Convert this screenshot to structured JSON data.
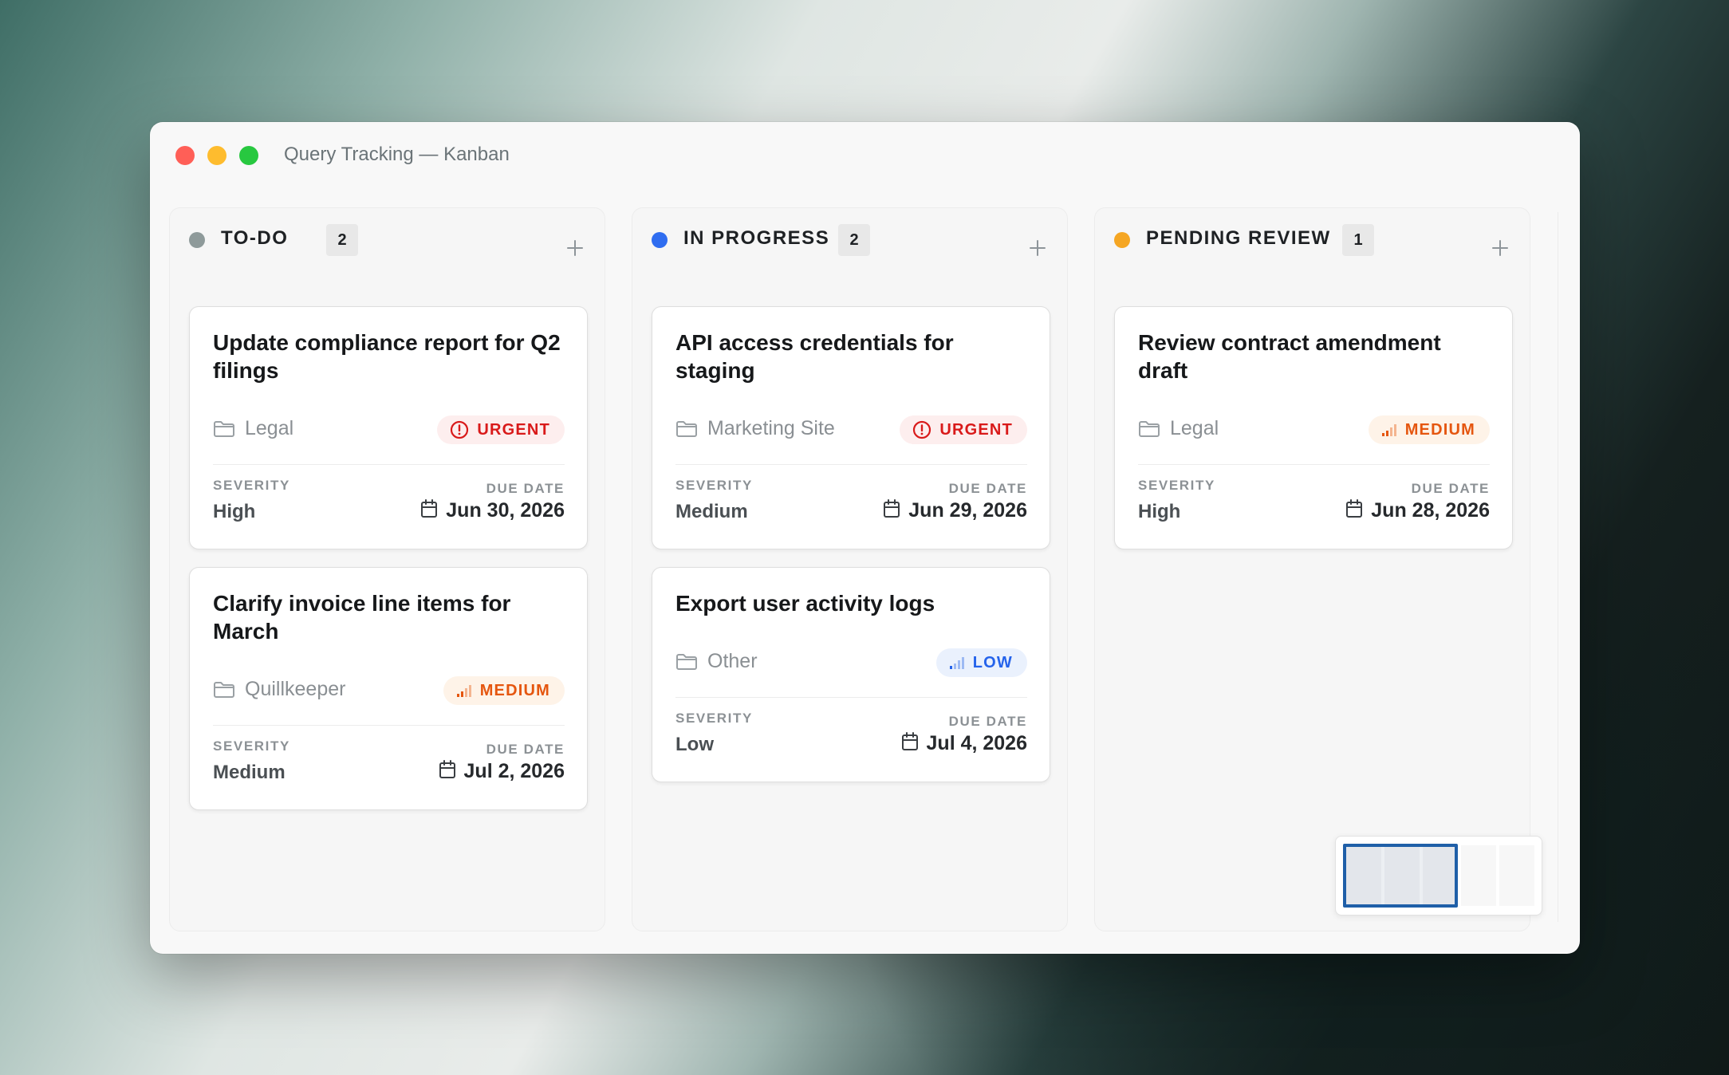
{
  "window": {
    "title": "Query Tracking — Kanban"
  },
  "columns": [
    {
      "title": "TO-DO",
      "count": "2",
      "dot_color": "#8e9a9a",
      "add_label": "+",
      "cards": [
        {
          "title": "Update compliance report for Q2 filings",
          "project": "Legal",
          "priority": "URGENT",
          "priority_kind": "urgent",
          "severity_label": "SEVERITY",
          "severity": "High",
          "due_label": "DUE DATE",
          "due_date": "Jun 30, 2026"
        },
        {
          "title": "Clarify invoice line items for March",
          "project": "Quillkeeper",
          "priority": "MEDIUM",
          "priority_kind": "medium",
          "severity_label": "SEVERITY",
          "severity": "Medium",
          "due_label": "DUE DATE",
          "due_date": "Jul 2, 2026"
        }
      ]
    },
    {
      "title": "IN PROGRESS",
      "count": "2",
      "dot_color": "#2f6df0",
      "add_label": "+",
      "cards": [
        {
          "title": "API access credentials for staging",
          "project": "Marketing Site",
          "priority": "URGENT",
          "priority_kind": "urgent",
          "severity_label": "SEVERITY",
          "severity": "Medium",
          "due_label": "DUE DATE",
          "due_date": "Jun 29, 2026"
        },
        {
          "title": "Export user activity logs",
          "project": "Other",
          "priority": "LOW",
          "priority_kind": "low",
          "severity_label": "SEVERITY",
          "severity": "Low",
          "due_label": "DUE DATE",
          "due_date": "Jul 4, 2026"
        }
      ]
    },
    {
      "title": "PENDING REVIEW",
      "count": "1",
      "dot_color": "#f5a623",
      "add_label": "+",
      "cards": [
        {
          "title": "Review contract amendment draft",
          "project": "Legal",
          "priority": "MEDIUM",
          "priority_kind": "medium",
          "severity_label": "SEVERITY",
          "severity": "High",
          "due_label": "DUE DATE",
          "due_date": "Jun 28, 2026"
        }
      ]
    }
  ],
  "icons": {
    "folder": "folder-icon",
    "calendar": "calendar-icon",
    "urgent": "alert-circle-icon",
    "medium": "signal-medium-icon",
    "low": "signal-low-icon",
    "add": "plus-icon"
  }
}
